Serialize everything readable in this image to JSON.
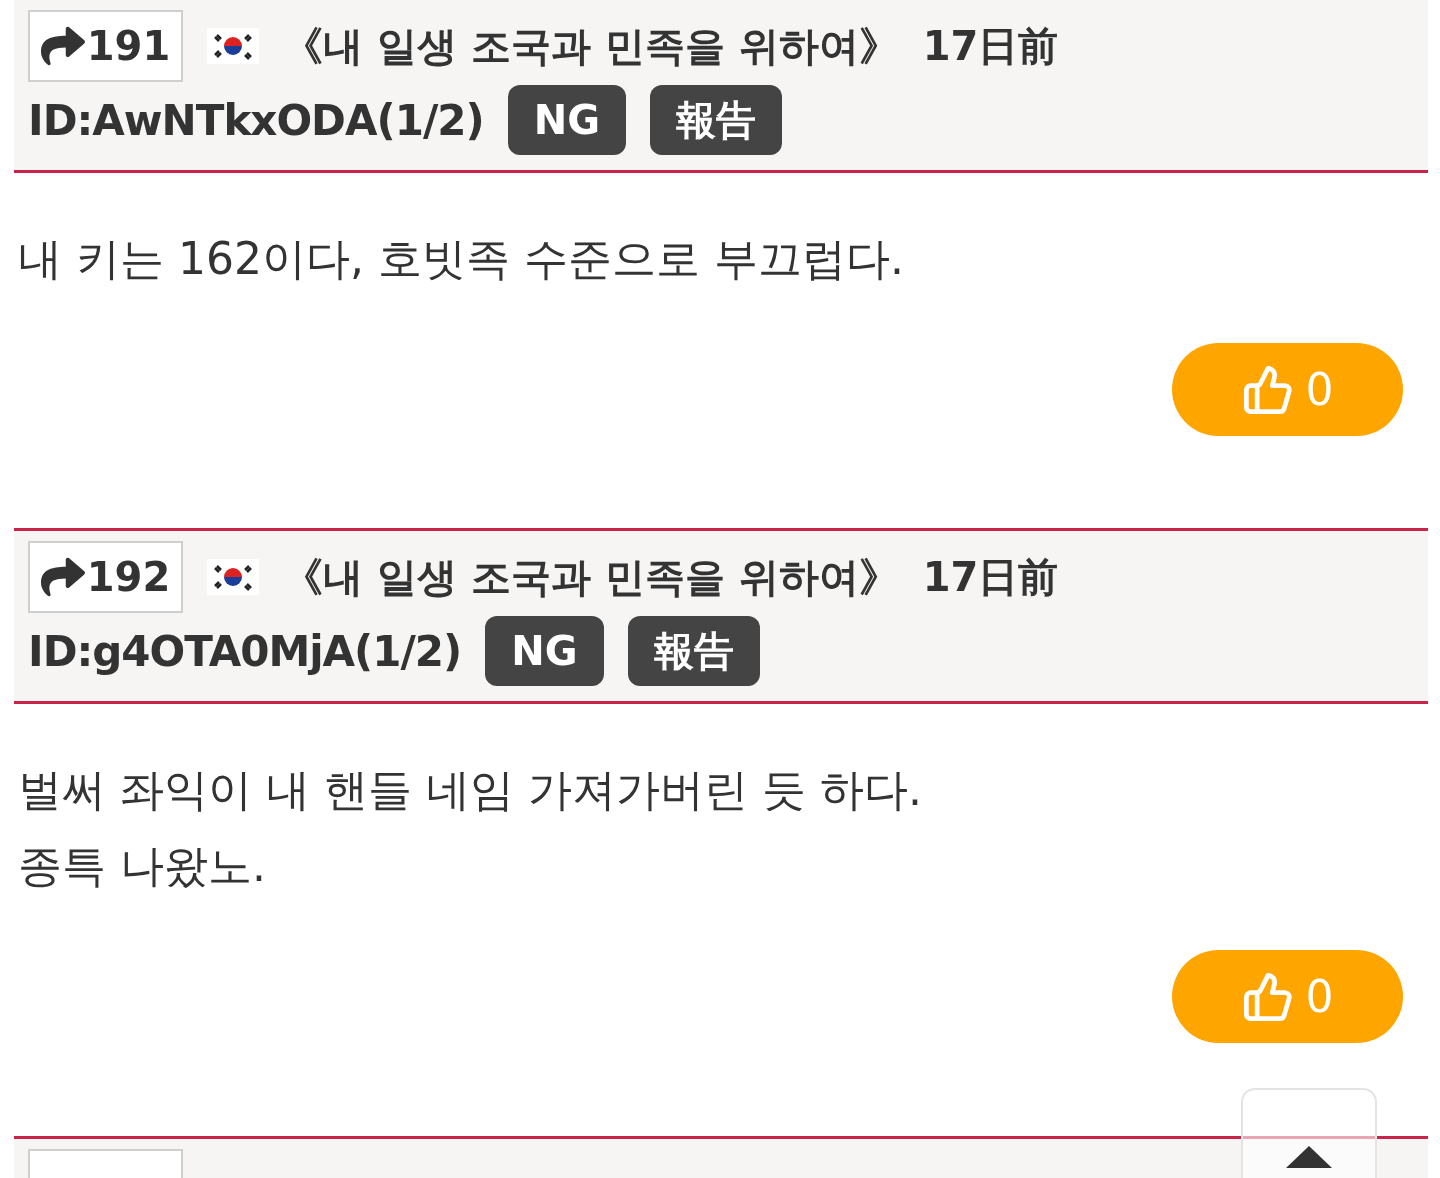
{
  "posts": [
    {
      "number": "191",
      "title": "《내 일생 조국과 민족을 위하여》",
      "date": "17日前",
      "id": "ID:AwNTkxODA(1/2)",
      "buttons": [
        "NG",
        "報告"
      ],
      "body": [
        "내 키는 162이다, 호빗족 수준으로 부끄럽다."
      ],
      "likes": "0"
    },
    {
      "number": "192",
      "title": "《내 일생 조국과 민족을 위하여》",
      "date": "17日前",
      "id": "ID:g4OTA0MjA(1/2)",
      "buttons": [
        "NG",
        "報告"
      ],
      "body": [
        "벌써 좌익이 내 핸들 네임 가져가버린 듯 하다.",
        "종특 나왔노."
      ],
      "likes": "0"
    }
  ]
}
